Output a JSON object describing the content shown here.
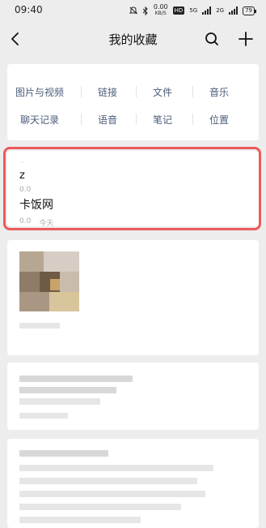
{
  "status_bar": {
    "time": "09:40",
    "speed_value": "0.00",
    "speed_unit": "KB/S",
    "hd_label": "HD",
    "net1": "5G",
    "net2": "2G",
    "battery": "79"
  },
  "header": {
    "title": "我的收藏",
    "back_icon": "chevron-left-icon",
    "search_icon": "search-icon",
    "add_icon": "plus-icon"
  },
  "categories": [
    {
      "label": "图片与视频"
    },
    {
      "label": "链接"
    },
    {
      "label": "文件"
    },
    {
      "label": "音乐"
    },
    {
      "label": "聊天记录"
    },
    {
      "label": "语音"
    },
    {
      "label": "笔记"
    },
    {
      "label": "位置"
    }
  ],
  "favorites": {
    "item1": {
      "dot": "·",
      "from": "z",
      "sub": "0.0",
      "title": "卡饭网",
      "source": "0.0",
      "date": "今天"
    }
  },
  "colors": {
    "background": "#ededed",
    "card": "#ffffff",
    "category_text": "#4b5d7a",
    "highlight": "#ec5a5a"
  }
}
